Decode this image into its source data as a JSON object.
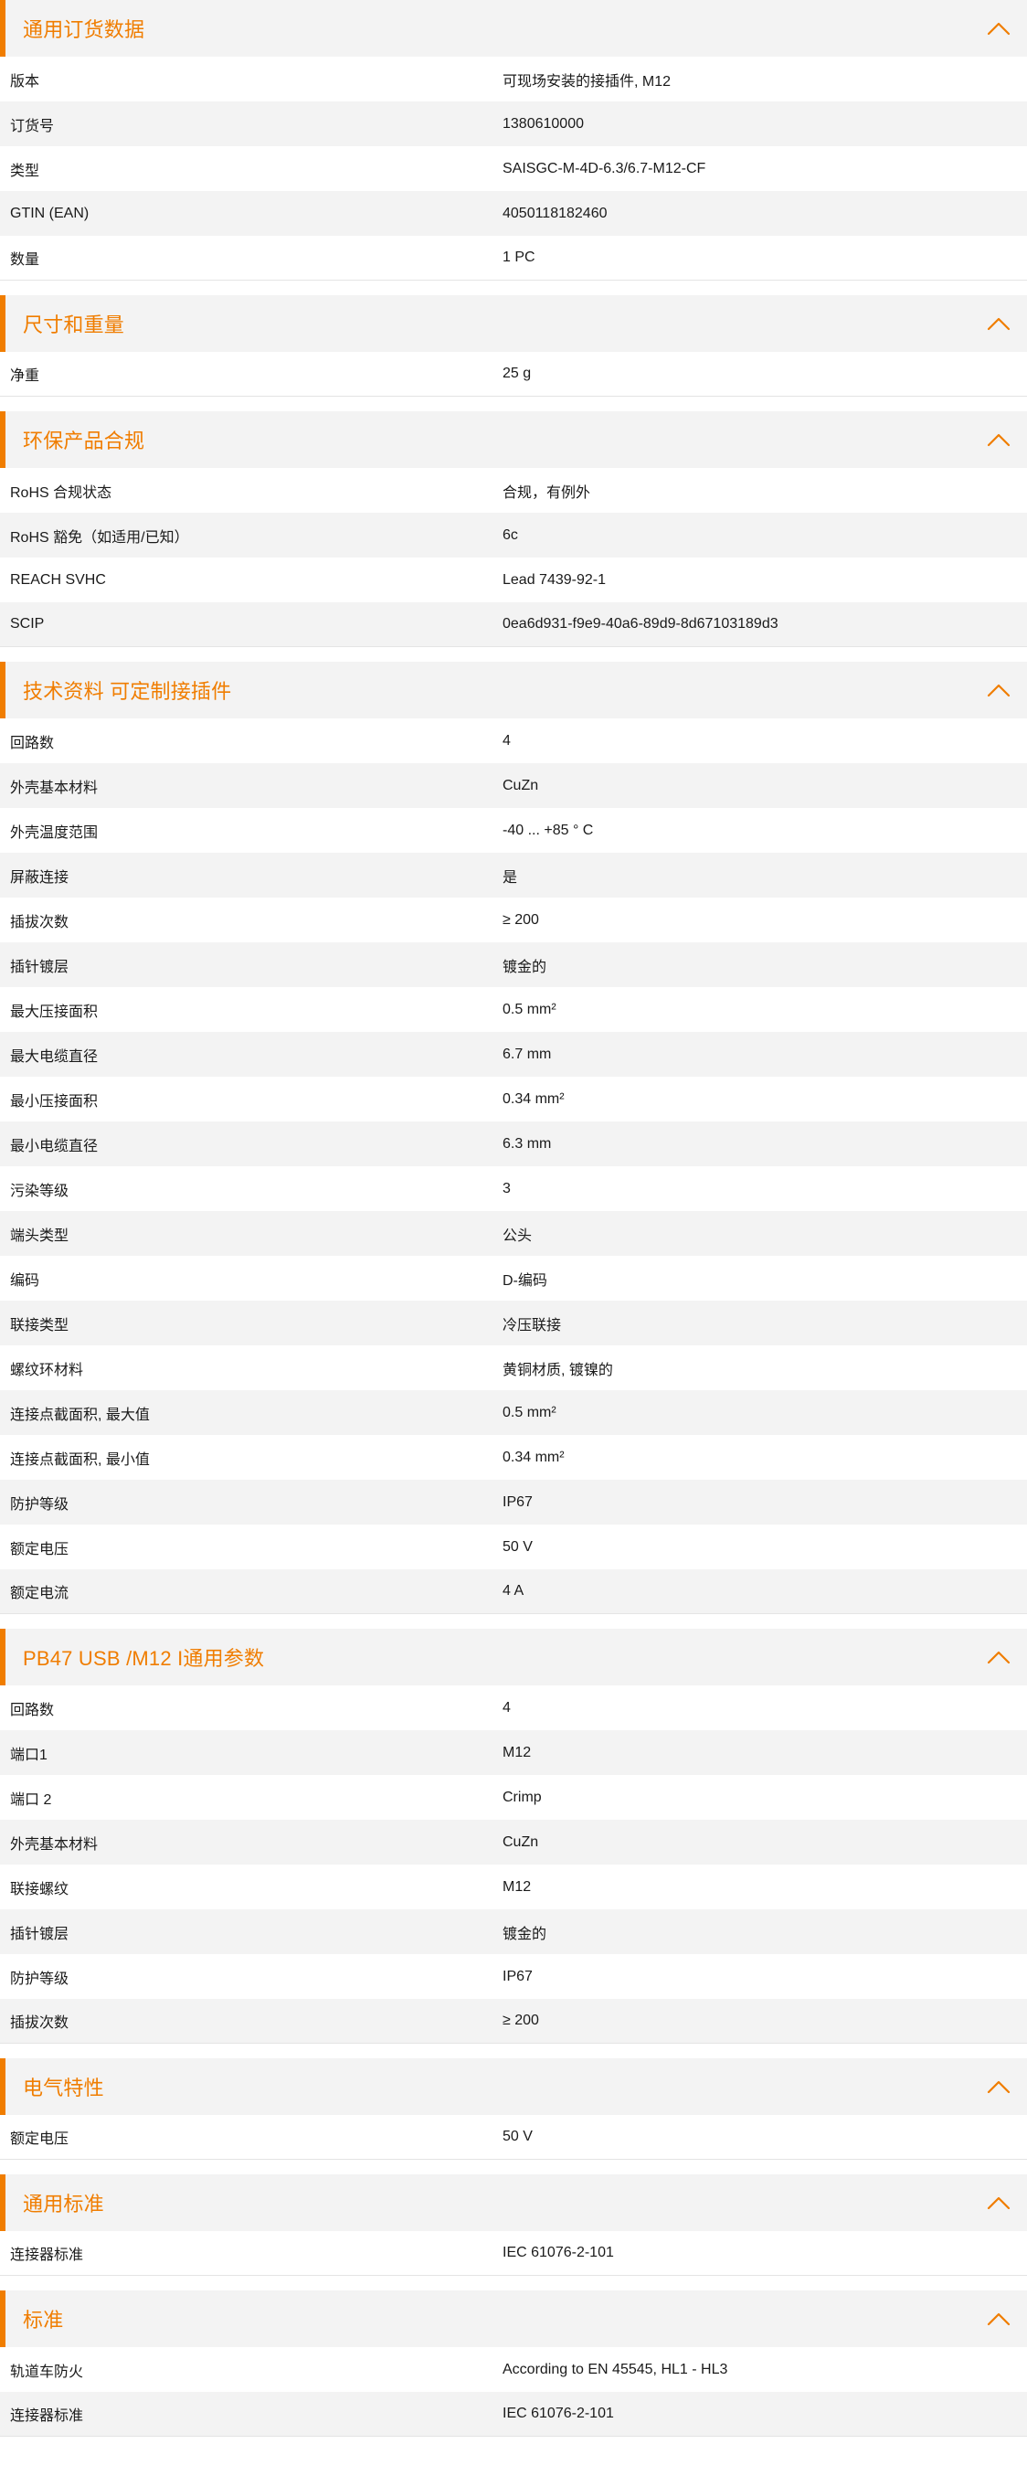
{
  "colors": {
    "accent": "#f07d00",
    "header_bg": "#f3f3f3",
    "alt_row_bg": "#f3f3f3",
    "text": "#1a1a1a"
  },
  "icons": {
    "section_toggle": "chevron-up-icon"
  },
  "sections": [
    {
      "title": "通用订货数据",
      "rows": [
        {
          "label": "版本",
          "value": "可现场安装的接插件, M12"
        },
        {
          "label": "订货号",
          "value": "1380610000"
        },
        {
          "label": "类型",
          "value": "SAISGC-M-4D-6.3/6.7-M12-CF"
        },
        {
          "label": "GTIN (EAN)",
          "value": "4050118182460"
        },
        {
          "label": "数量",
          "value": "1  PC"
        }
      ]
    },
    {
      "title": "尺寸和重量",
      "rows": [
        {
          "label": "净重",
          "value": "25  g"
        }
      ]
    },
    {
      "title": "环保产品合规",
      "rows": [
        {
          "label": "RoHS 合规状态",
          "value": "合规，有例外"
        },
        {
          "label": "RoHS 豁免（如适用/已知）",
          "value": "6c"
        },
        {
          "label": "REACH SVHC",
          "value": "Lead 7439-92-1"
        },
        {
          "label": "SCIP",
          "value": "0ea6d931-f9e9-40a6-89d9-8d67103189d3"
        }
      ]
    },
    {
      "title": "技术资料 可定制接插件",
      "rows": [
        {
          "label": "回路数",
          "value": "4"
        },
        {
          "label": "外壳基本材料",
          "value": "CuZn"
        },
        {
          "label": "外壳温度范围",
          "value": "-40 ... +85 ° C"
        },
        {
          "label": "屏蔽连接",
          "value": "是"
        },
        {
          "label": "插拔次数",
          "value": "≥ 200"
        },
        {
          "label": "插针镀层",
          "value": "镀金的"
        },
        {
          "label": "最大压接面积",
          "value": "0.5  mm²"
        },
        {
          "label": "最大电缆直径",
          "value": "6.7  mm"
        },
        {
          "label": "最小压接面积",
          "value": "0.34  mm²"
        },
        {
          "label": "最小电缆直径",
          "value": "6.3  mm"
        },
        {
          "label": "污染等级",
          "value": "3"
        },
        {
          "label": "端头类型",
          "value": "公头"
        },
        {
          "label": "编码",
          "value": "D-编码"
        },
        {
          "label": "联接类型",
          "value": "冷压联接"
        },
        {
          "label": "螺纹环材料",
          "value": "黄铜材质, 镀镍的"
        },
        {
          "label": "连接点截面积, 最大值",
          "value": "0.5  mm²"
        },
        {
          "label": "连接点截面积, 最小值",
          "value": "0.34  mm²"
        },
        {
          "label": "防护等级",
          "value": "IP67"
        },
        {
          "label": "额定电压",
          "value": "50  V"
        },
        {
          "label": "额定电流",
          "value": "4  A"
        }
      ]
    },
    {
      "title": "PB47 USB /M12 I通用参数",
      "rows": [
        {
          "label": "回路数",
          "value": "4"
        },
        {
          "label": "端口1",
          "value": "M12"
        },
        {
          "label": "端口 2",
          "value": "Crimp"
        },
        {
          "label": "外壳基本材料",
          "value": "CuZn"
        },
        {
          "label": "联接螺纹",
          "value": "M12"
        },
        {
          "label": "插针镀层",
          "value": "镀金的"
        },
        {
          "label": "防护等级",
          "value": "IP67"
        },
        {
          "label": "插拔次数",
          "value": "≥ 200"
        }
      ]
    },
    {
      "title": "电气特性",
      "rows": [
        {
          "label": "额定电压",
          "value": "50  V"
        }
      ]
    },
    {
      "title": "通用标准",
      "rows": [
        {
          "label": "连接器标准",
          "value": "IEC 61076-2-101"
        }
      ]
    },
    {
      "title": "标准",
      "rows": [
        {
          "label": "轨道车防火",
          "value": "According to EN 45545, HL1 - HL3"
        },
        {
          "label": "连接器标准",
          "value": "IEC 61076-2-101"
        }
      ]
    }
  ]
}
